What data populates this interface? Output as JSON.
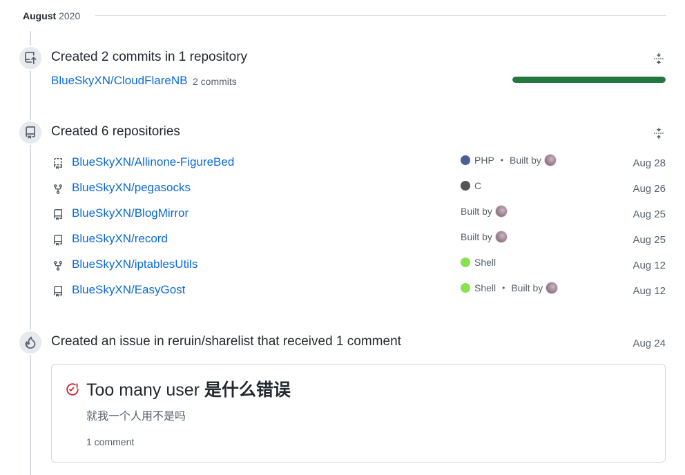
{
  "month": {
    "name": "August",
    "year": "2020"
  },
  "commits": {
    "heading": "Created 2 commits in 1 repository",
    "repo": "BlueSkyXN/CloudFlareNB",
    "count": "2 commits",
    "bar_fraction": 1.0,
    "bar_color": "#24783e"
  },
  "repositories": {
    "heading": "Created 6 repositories",
    "items": [
      {
        "name": "BlueSkyXN/Allinone-FigureBed",
        "icon": "template-repo-icon",
        "language": "PHP",
        "lang_color": "#4F5D95",
        "built_by": "Built by",
        "date": "Aug 28"
      },
      {
        "name": "BlueSkyXN/pegasocks",
        "icon": "fork-icon",
        "language": "C",
        "lang_color": "#555555",
        "built_by": "",
        "date": "Aug 26"
      },
      {
        "name": "BlueSkyXN/BlogMirror",
        "icon": "repo-icon",
        "language": "",
        "lang_color": "",
        "built_by": "Built by",
        "date": "Aug 25"
      },
      {
        "name": "BlueSkyXN/record",
        "icon": "repo-icon",
        "language": "",
        "lang_color": "",
        "built_by": "Built by",
        "date": "Aug 25"
      },
      {
        "name": "BlueSkyXN/iptablesUtils",
        "icon": "fork-icon",
        "language": "Shell",
        "lang_color": "#89e051",
        "built_by": "",
        "date": "Aug 12"
      },
      {
        "name": "BlueSkyXN/EasyGost",
        "icon": "repo-icon",
        "language": "Shell",
        "lang_color": "#89e051",
        "built_by": "Built by",
        "date": "Aug 12"
      }
    ]
  },
  "issue": {
    "heading": "Created an issue in reruin/sharelist that received 1 comment",
    "date": "Aug 24",
    "title_prefix": "Too many user ",
    "title_cjk": "是什么错误",
    "body": "就我一个人用不是吗",
    "comments": "1 comment",
    "icon_color": "#cf222e"
  }
}
